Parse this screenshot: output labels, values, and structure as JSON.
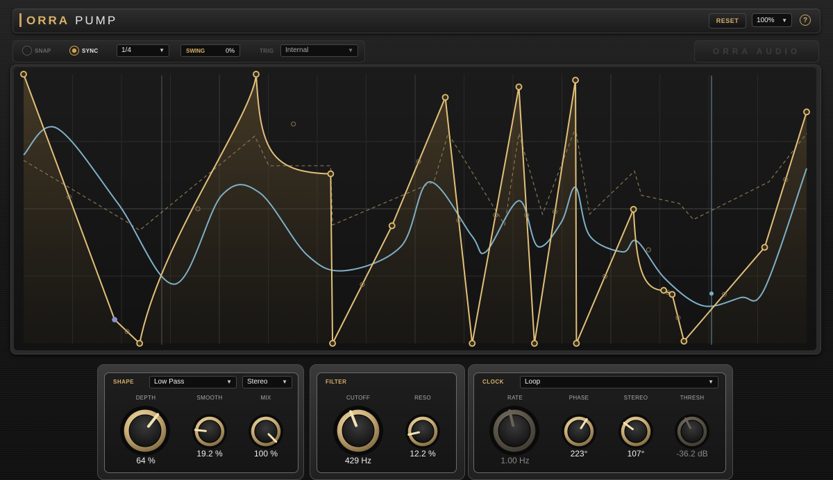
{
  "header": {
    "brand_primary": "ORRA",
    "brand_secondary": "PUMP",
    "reset_label": "RESET",
    "zoom_value": "100%",
    "help_label": "?"
  },
  "toolbar": {
    "snap_label": "SNAP",
    "snap_on": false,
    "sync_label": "SYNC",
    "sync_on": true,
    "division_value": "1/4",
    "swing_label": "SWING",
    "swing_value": "0%",
    "trig_label": "TRIG",
    "trig_value": "Internal",
    "brand_plate": "ORRA AUDIO"
  },
  "colors": {
    "accent": "#d8b26a",
    "curve": "#e2c07a",
    "lfo_trace": "#7fb0c8",
    "background": "#141414"
  },
  "shape_panel": {
    "title": "SHAPE",
    "filter_type": "Low Pass",
    "channel_mode": "Stereo",
    "knobs": [
      {
        "label": "DEPTH",
        "value": "64 %",
        "level": 0.64,
        "enabled": true
      },
      {
        "label": "SMOOTH",
        "value": "19.2 %",
        "level": 0.19,
        "enabled": true
      },
      {
        "label": "MIX",
        "value": "100 %",
        "level": 1.0,
        "enabled": true
      }
    ]
  },
  "filter_panel": {
    "title": "FILTER",
    "knobs": [
      {
        "label": "CUTOFF",
        "value": "429 Hz",
        "level": 0.42,
        "enabled": true
      },
      {
        "label": "RESO",
        "value": "12.2 %",
        "level": 0.12,
        "enabled": true
      }
    ]
  },
  "clock_panel": {
    "title": "CLOCK",
    "mode": "Loop",
    "knobs": [
      {
        "label": "RATE",
        "value": "1.00 Hz",
        "level": 0.45,
        "enabled": false
      },
      {
        "label": "PHASE",
        "value": "223°",
        "level": 0.62,
        "enabled": true
      },
      {
        "label": "STEREO",
        "value": "107°",
        "level": 0.3,
        "enabled": true
      },
      {
        "label": "THRESH",
        "value": "-36.2 dB",
        "level": 0.4,
        "enabled": false
      }
    ]
  },
  "envelope": {
    "nodes": [
      [
        0.0,
        1.0
      ],
      [
        0.193,
        0.088
      ],
      [
        0.246,
        0.0
      ],
      [
        0.493,
        1.0
      ],
      [
        0.651,
        0.63
      ],
      [
        0.655,
        0.0
      ],
      [
        0.781,
        0.437
      ],
      [
        0.894,
        0.914
      ],
      [
        0.951,
        0.0
      ],
      [
        1.05,
        0.953
      ],
      [
        1.083,
        0.0
      ],
      [
        1.17,
        0.978
      ],
      [
        1.172,
        0.0
      ],
      [
        1.293,
        0.498
      ],
      [
        1.357,
        0.197
      ],
      [
        1.375,
        0.182
      ],
      [
        1.4,
        0.008
      ],
      [
        1.571,
        0.357
      ],
      [
        1.66,
        0.86
      ]
    ],
    "end_curve": [
      [
        1.66,
        0.86
      ]
    ],
    "secondary_nodes": [
      0.193
    ],
    "dashed_overlay": true
  }
}
